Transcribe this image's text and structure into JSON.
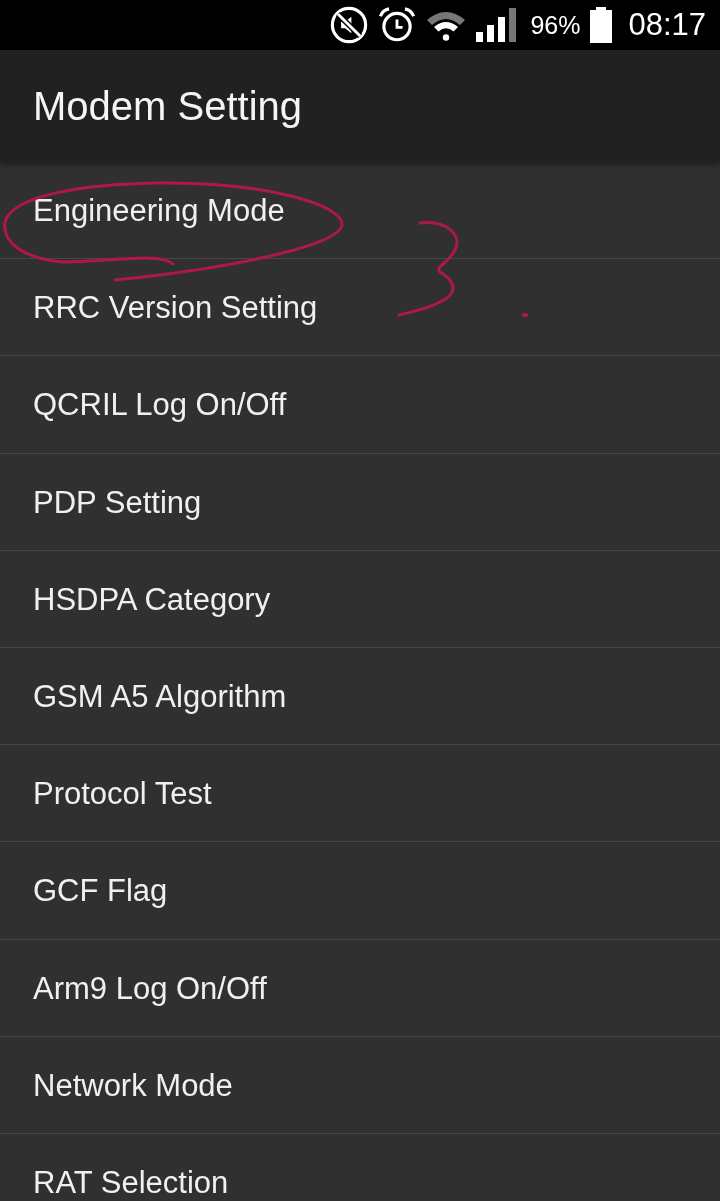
{
  "status_bar": {
    "battery_percent": "96%",
    "time": "08:17"
  },
  "app_bar": {
    "title": "Modem Setting"
  },
  "menu_items": [
    {
      "label": "Engineering Mode"
    },
    {
      "label": "RRC Version Setting"
    },
    {
      "label": "QCRIL Log On/Off"
    },
    {
      "label": "PDP Setting"
    },
    {
      "label": "HSDPA Category"
    },
    {
      "label": "GSM A5 Algorithm"
    },
    {
      "label": "Protocol Test"
    },
    {
      "label": "GCF Flag"
    },
    {
      "label": "Arm9 Log On/Off"
    },
    {
      "label": "Network Mode"
    },
    {
      "label": "RAT Selection"
    }
  ]
}
